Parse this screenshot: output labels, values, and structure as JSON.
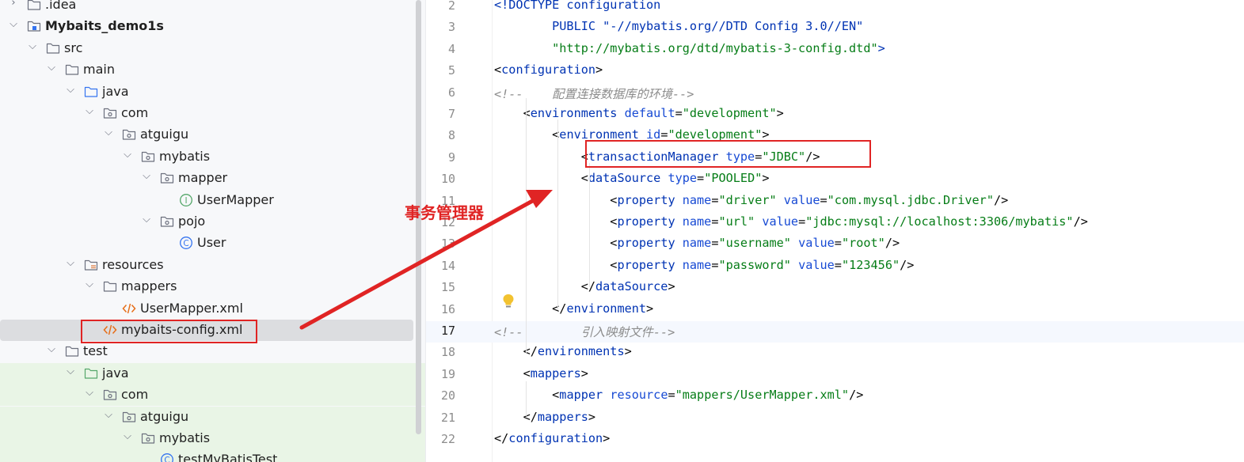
{
  "tree": {
    "rows": [
      {
        "label": ".idea",
        "level": 0,
        "kind": "folder",
        "expanded": false
      },
      {
        "label": "Mybaits_demo1s",
        "level": 0,
        "kind": "module",
        "expanded": true,
        "bold": true
      },
      {
        "label": "src",
        "level": 1,
        "kind": "folder",
        "expanded": true
      },
      {
        "label": "main",
        "level": 2,
        "kind": "folder",
        "expanded": true
      },
      {
        "label": "java",
        "level": 3,
        "kind": "source-folder",
        "expanded": true
      },
      {
        "label": "com",
        "level": 4,
        "kind": "package",
        "expanded": true
      },
      {
        "label": "atguigu",
        "level": 5,
        "kind": "package",
        "expanded": true
      },
      {
        "label": "mybatis",
        "level": 6,
        "kind": "package",
        "expanded": true
      },
      {
        "label": "mapper",
        "level": 7,
        "kind": "package",
        "expanded": true
      },
      {
        "label": "UserMapper",
        "level": 8,
        "kind": "interface"
      },
      {
        "label": "pojo",
        "level": 7,
        "kind": "package",
        "expanded": true
      },
      {
        "label": "User",
        "level": 8,
        "kind": "class"
      },
      {
        "label": "resources",
        "level": 3,
        "kind": "resources-folder",
        "expanded": true
      },
      {
        "label": "mappers",
        "level": 4,
        "kind": "folder",
        "expanded": true
      },
      {
        "label": "UserMapper.xml",
        "level": 5,
        "kind": "xml"
      },
      {
        "label": "mybaits-config.xml",
        "level": 4,
        "kind": "xml",
        "selected": true
      },
      {
        "label": "test",
        "level": 2,
        "kind": "folder",
        "expanded": true
      },
      {
        "label": "java",
        "level": 3,
        "kind": "test-folder",
        "expanded": true,
        "test": true
      },
      {
        "label": "com",
        "level": 4,
        "kind": "package",
        "expanded": true,
        "test": true
      },
      {
        "label": "atguigu",
        "level": 5,
        "kind": "package",
        "expanded": true,
        "test": true
      },
      {
        "label": "mybatis",
        "level": 6,
        "kind": "package",
        "expanded": true,
        "test": true
      },
      {
        "label": "testMyBatisTest",
        "level": 7,
        "kind": "class",
        "test": true
      }
    ]
  },
  "editor": {
    "current_line": 17,
    "lines": [
      {
        "n": "2",
        "tokens": [
          [
            "t-tag",
            "<!DOCTYPE configuration"
          ]
        ]
      },
      {
        "n": "3",
        "tokens": [
          [
            "t-tag",
            "        PUBLIC \"-//mybatis.org//DTD Config 3.0//EN\""
          ]
        ]
      },
      {
        "n": "4",
        "tokens": [
          [
            "t-val",
            "        \"http://mybatis.org/dtd/mybatis-3-config.dtd\""
          ],
          [
            "t-tag",
            ">"
          ]
        ]
      },
      {
        "n": "5",
        "tokens": [
          [
            "t-plain",
            "<"
          ],
          [
            "t-tag",
            "configuration"
          ],
          [
            "t-plain",
            ">"
          ]
        ]
      },
      {
        "n": "6",
        "tokens": [
          [
            "t-cmt",
            "<!--    配置连接数据库的环境-->"
          ]
        ]
      },
      {
        "n": "7",
        "tokens": [
          [
            "t-plain",
            "    <"
          ],
          [
            "t-tag",
            "environments "
          ],
          [
            "t-attr",
            "default"
          ],
          [
            "t-plain",
            "="
          ],
          [
            "t-val",
            "\"development\""
          ],
          [
            "t-plain",
            ">"
          ]
        ]
      },
      {
        "n": "8",
        "tokens": [
          [
            "t-plain",
            "        <"
          ],
          [
            "t-tag",
            "environment "
          ],
          [
            "t-attr",
            "id"
          ],
          [
            "t-plain",
            "="
          ],
          [
            "t-val",
            "\"development\""
          ],
          [
            "t-plain",
            ">"
          ]
        ]
      },
      {
        "n": "9",
        "tokens": [
          [
            "t-plain",
            "            <"
          ],
          [
            "t-tag",
            "transactionManager "
          ],
          [
            "t-attr",
            "type"
          ],
          [
            "t-plain",
            "="
          ],
          [
            "t-val",
            "\"JDBC\""
          ],
          [
            "t-plain",
            "/>"
          ]
        ]
      },
      {
        "n": "10",
        "tokens": [
          [
            "t-plain",
            "            <"
          ],
          [
            "t-tag",
            "dataSource "
          ],
          [
            "t-attr",
            "type"
          ],
          [
            "t-plain",
            "="
          ],
          [
            "t-val",
            "\"POOLED\""
          ],
          [
            "t-plain",
            ">"
          ]
        ]
      },
      {
        "n": "11",
        "tokens": [
          [
            "t-plain",
            "                <"
          ],
          [
            "t-tag",
            "property "
          ],
          [
            "t-attr",
            "name"
          ],
          [
            "t-plain",
            "="
          ],
          [
            "t-val",
            "\"driver\" "
          ],
          [
            "t-attr",
            "value"
          ],
          [
            "t-plain",
            "="
          ],
          [
            "t-val",
            "\"com.mysql.jdbc.Driver\""
          ],
          [
            "t-plain",
            "/>"
          ]
        ]
      },
      {
        "n": "12",
        "tokens": [
          [
            "t-plain",
            "                <"
          ],
          [
            "t-tag",
            "property "
          ],
          [
            "t-attr",
            "name"
          ],
          [
            "t-plain",
            "="
          ],
          [
            "t-val",
            "\"url\" "
          ],
          [
            "t-attr",
            "value"
          ],
          [
            "t-plain",
            "="
          ],
          [
            "t-val",
            "\"jdbc:mysql://localhost:3306/mybatis\""
          ],
          [
            "t-plain",
            "/>"
          ]
        ]
      },
      {
        "n": "13",
        "tokens": [
          [
            "t-plain",
            "                <"
          ],
          [
            "t-tag",
            "property "
          ],
          [
            "t-attr",
            "name"
          ],
          [
            "t-plain",
            "="
          ],
          [
            "t-val",
            "\"username\" "
          ],
          [
            "t-attr",
            "value"
          ],
          [
            "t-plain",
            "="
          ],
          [
            "t-val",
            "\"root\""
          ],
          [
            "t-plain",
            "/>"
          ]
        ]
      },
      {
        "n": "14",
        "tokens": [
          [
            "t-plain",
            "                <"
          ],
          [
            "t-tag",
            "property "
          ],
          [
            "t-attr",
            "name"
          ],
          [
            "t-plain",
            "="
          ],
          [
            "t-val",
            "\"password\" "
          ],
          [
            "t-attr",
            "value"
          ],
          [
            "t-plain",
            "="
          ],
          [
            "t-val",
            "\"123456\""
          ],
          [
            "t-plain",
            "/>"
          ]
        ]
      },
      {
        "n": "15",
        "tokens": [
          [
            "t-plain",
            "            </"
          ],
          [
            "t-tag",
            "dataSource"
          ],
          [
            "t-plain",
            ">"
          ]
        ]
      },
      {
        "n": "16",
        "tokens": [
          [
            "t-plain",
            "        </"
          ],
          [
            "t-tag",
            "environment"
          ],
          [
            "t-plain",
            ">"
          ]
        ]
      },
      {
        "n": "17",
        "tokens": [
          [
            "t-cmt",
            "<!--        引入映射文件-->"
          ]
        ]
      },
      {
        "n": "18",
        "tokens": [
          [
            "t-plain",
            "    </"
          ],
          [
            "t-tag",
            "environments"
          ],
          [
            "t-plain",
            ">"
          ]
        ]
      },
      {
        "n": "19",
        "tokens": [
          [
            "t-plain",
            "    <"
          ],
          [
            "t-tag",
            "mappers"
          ],
          [
            "t-plain",
            ">"
          ]
        ]
      },
      {
        "n": "20",
        "tokens": [
          [
            "t-plain",
            "        <"
          ],
          [
            "t-tag",
            "mapper "
          ],
          [
            "t-attr",
            "resource"
          ],
          [
            "t-plain",
            "="
          ],
          [
            "t-val",
            "\"mappers/UserMapper.xml\""
          ],
          [
            "t-plain",
            "/>"
          ]
        ]
      },
      {
        "n": "21",
        "tokens": [
          [
            "t-plain",
            "    </"
          ],
          [
            "t-tag",
            "mappers"
          ],
          [
            "t-plain",
            ">"
          ]
        ]
      },
      {
        "n": "22",
        "tokens": [
          [
            "t-plain",
            "</"
          ],
          [
            "t-tag",
            "configuration"
          ],
          [
            "t-plain",
            ">"
          ]
        ]
      }
    ]
  },
  "annotation": {
    "text": "事务管理器",
    "color": "#e02424"
  },
  "colors": {
    "tag": "#0033b3",
    "attr": "#174ad4",
    "value": "#067d17",
    "comment": "#8c8c8c",
    "test_bg": "#e9f5e6",
    "selection": "#dcdde0"
  }
}
